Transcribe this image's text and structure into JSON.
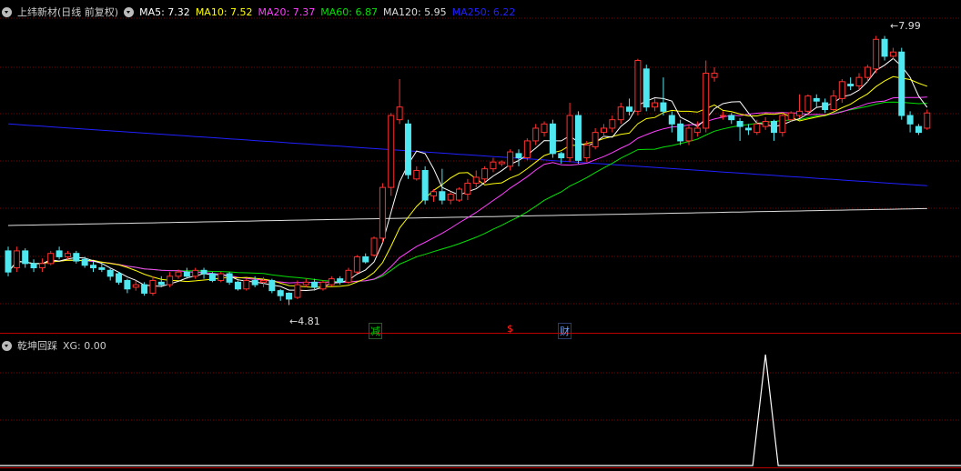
{
  "main_legend": {
    "stock": "上纬新材(日线 前复权)",
    "ma": [
      {
        "label": "MA5: 7.32",
        "color": "#ffffff"
      },
      {
        "label": "MA10: 7.52",
        "color": "#ffff00"
      },
      {
        "label": "MA20: 7.37",
        "color": "#ff40ff"
      },
      {
        "label": "MA60: 6.87",
        "color": "#00e000"
      },
      {
        "label": "MA120: 5.95",
        "color": "#dddddd"
      },
      {
        "label": "MA250: 6.22",
        "color": "#2020ff"
      }
    ]
  },
  "sub_legend": {
    "indicator": "乾坤回踩",
    "value_text": "XG: 0.00"
  },
  "annotations": {
    "high_label": "7.99",
    "low_label": "4.81",
    "markers": [
      {
        "text": "减",
        "color": "#00d000"
      },
      {
        "text": "$",
        "color": "#ff2020"
      },
      {
        "text": "财",
        "color": "#6aa0ff"
      }
    ]
  },
  "colors": {
    "up": "#ff3030",
    "down": "#50e8f0",
    "grid": "#7a0000",
    "ma5": "#ffffff",
    "ma10": "#ffff00",
    "ma20": "#ff40ff",
    "ma60": "#00e000",
    "ma120": "#dddddd",
    "ma250": "#2020ff",
    "xg": "#ffffff"
  },
  "chart_data": [
    {
      "type": "candlestick",
      "ylim": [
        4.6,
        8.2
      ],
      "candles": [
        [
          5.45,
          5.2,
          5.5,
          5.15
        ],
        [
          5.25,
          5.45,
          5.5,
          5.2
        ],
        [
          5.45,
          5.3,
          5.48,
          5.25
        ],
        [
          5.3,
          5.25,
          5.35,
          5.2
        ],
        [
          5.25,
          5.3,
          5.36,
          5.2
        ],
        [
          5.3,
          5.42,
          5.45,
          5.28
        ],
        [
          5.45,
          5.38,
          5.5,
          5.35
        ],
        [
          5.38,
          5.42,
          5.45,
          5.35
        ],
        [
          5.42,
          5.33,
          5.45,
          5.3
        ],
        [
          5.35,
          5.28,
          5.38,
          5.25
        ],
        [
          5.28,
          5.25,
          5.32,
          5.2
        ],
        [
          5.25,
          5.23,
          5.3,
          5.2
        ],
        [
          5.22,
          5.15,
          5.25,
          5.1
        ],
        [
          5.18,
          5.08,
          5.2,
          5.05
        ],
        [
          5.1,
          5.0,
          5.12,
          4.95
        ],
        [
          5.02,
          5.05,
          5.1,
          4.98
        ],
        [
          5.05,
          4.95,
          5.08,
          4.92
        ],
        [
          4.95,
          5.1,
          5.15,
          4.92
        ],
        [
          5.08,
          5.05,
          5.15,
          5.02
        ],
        [
          5.05,
          5.15,
          5.2,
          5.02
        ],
        [
          5.15,
          5.2,
          5.23,
          5.12
        ],
        [
          5.2,
          5.15,
          5.25,
          5.12
        ],
        [
          5.15,
          5.22,
          5.25,
          5.12
        ],
        [
          5.22,
          5.18,
          5.25,
          5.12
        ],
        [
          5.18,
          5.1,
          5.2,
          5.08
        ],
        [
          5.1,
          5.18,
          5.2,
          5.08
        ],
        [
          5.18,
          5.08,
          5.2,
          5.05
        ],
        [
          5.08,
          5.0,
          5.1,
          4.98
        ],
        [
          5.0,
          5.1,
          5.12,
          4.98
        ],
        [
          5.1,
          5.05,
          5.15,
          5.02
        ],
        [
          5.08,
          5.1,
          5.14,
          5.02
        ],
        [
          5.1,
          4.98,
          5.12,
          4.95
        ],
        [
          4.98,
          4.92,
          5.0,
          4.86
        ],
        [
          4.95,
          4.88,
          4.96,
          4.81
        ],
        [
          4.9,
          5.05,
          5.1,
          4.88
        ],
        [
          5.05,
          5.08,
          5.12,
          5.02
        ],
        [
          5.08,
          5.02,
          5.12,
          4.98
        ],
        [
          5.0,
          5.08,
          5.1,
          4.98
        ],
        [
          5.05,
          5.12,
          5.15,
          5.03
        ],
        [
          5.12,
          5.08,
          5.15,
          5.05
        ],
        [
          5.08,
          5.22,
          5.25,
          5.06
        ],
        [
          5.2,
          5.38,
          5.4,
          5.18
        ],
        [
          5.38,
          5.32,
          5.42,
          5.3
        ],
        [
          5.4,
          5.6,
          5.62,
          5.38
        ],
        [
          5.6,
          6.2,
          6.25,
          5.55
        ],
        [
          6.2,
          7.05,
          7.08,
          6.1
        ],
        [
          7.0,
          7.15,
          7.48,
          6.95
        ],
        [
          6.95,
          6.35,
          7.0,
          6.3
        ],
        [
          6.3,
          6.4,
          6.45,
          6.28
        ],
        [
          6.4,
          6.05,
          6.45,
          6.0
        ],
        [
          6.1,
          6.15,
          6.18,
          6.03
        ],
        [
          6.15,
          6.05,
          6.42,
          6.0
        ],
        [
          6.05,
          6.12,
          6.15,
          6.0
        ],
        [
          6.05,
          6.18,
          6.2,
          6.03
        ],
        [
          6.12,
          6.25,
          6.3,
          6.05
        ],
        [
          6.25,
          6.32,
          6.4,
          6.2
        ],
        [
          6.3,
          6.42,
          6.45,
          6.25
        ],
        [
          6.42,
          6.5,
          6.55,
          6.38
        ],
        [
          6.48,
          6.5,
          6.52,
          6.45
        ],
        [
          6.45,
          6.62,
          6.65,
          6.4
        ],
        [
          6.6,
          6.55,
          6.65,
          6.45
        ],
        [
          6.55,
          6.75,
          6.78,
          6.52
        ],
        [
          6.75,
          6.9,
          6.95,
          6.7
        ],
        [
          6.85,
          6.95,
          6.98,
          6.8
        ],
        [
          6.95,
          6.6,
          7.0,
          6.55
        ],
        [
          6.6,
          6.55,
          6.62,
          6.48
        ],
        [
          6.55,
          7.05,
          7.2,
          6.5
        ],
        [
          7.05,
          6.52,
          7.1,
          6.48
        ],
        [
          6.55,
          6.7,
          6.75,
          6.5
        ],
        [
          6.68,
          6.85,
          6.9,
          6.65
        ],
        [
          6.85,
          6.9,
          6.95,
          6.8
        ],
        [
          6.9,
          7.0,
          7.05,
          6.85
        ],
        [
          7.0,
          7.15,
          7.2,
          6.95
        ],
        [
          7.15,
          7.1,
          7.25,
          7.05
        ],
        [
          7.1,
          7.7,
          7.72,
          7.05
        ],
        [
          7.6,
          7.15,
          7.65,
          7.1
        ],
        [
          7.15,
          7.2,
          7.25,
          7.1
        ],
        [
          7.2,
          7.1,
          7.5,
          7.05
        ],
        [
          7.05,
          6.95,
          7.1,
          6.85
        ],
        [
          6.95,
          6.75,
          7.0,
          6.7
        ],
        [
          6.75,
          6.9,
          6.95,
          6.7
        ],
        [
          6.85,
          6.9,
          6.98,
          6.8
        ],
        [
          6.9,
          7.55,
          7.7,
          6.85
        ],
        [
          7.5,
          7.55,
          7.62,
          7.45
        ],
        [
          7.05,
          7.05,
          7.1,
          7.0
        ],
        [
          7.05,
          7.0,
          7.08,
          6.95
        ],
        [
          6.98,
          6.92,
          7.02,
          6.75
        ],
        [
          6.9,
          6.88,
          6.95,
          6.82
        ],
        [
          6.85,
          6.95,
          7.0,
          6.82
        ],
        [
          6.92,
          6.98,
          7.03,
          6.88
        ],
        [
          6.98,
          6.85,
          7.0,
          6.75
        ],
        [
          6.85,
          7.05,
          7.08,
          6.8
        ],
        [
          7.0,
          7.08,
          7.1,
          6.98
        ],
        [
          7.05,
          7.1,
          7.3,
          7.02
        ],
        [
          7.1,
          7.28,
          7.3,
          7.05
        ],
        [
          7.25,
          7.22,
          7.3,
          7.15
        ],
        [
          7.2,
          7.12,
          7.25,
          7.08
        ],
        [
          7.12,
          7.28,
          7.35,
          7.1
        ],
        [
          7.25,
          7.45,
          7.48,
          7.2
        ],
        [
          7.42,
          7.4,
          7.5,
          7.35
        ],
        [
          7.4,
          7.5,
          7.55,
          7.35
        ],
        [
          7.5,
          7.62,
          7.65,
          7.45
        ],
        [
          7.6,
          7.95,
          7.99,
          7.55
        ],
        [
          7.95,
          7.75,
          7.99,
          7.7
        ],
        [
          7.75,
          7.8,
          7.85,
          7.72
        ],
        [
          7.8,
          7.05,
          7.85,
          7.0
        ],
        [
          7.05,
          6.95,
          7.1,
          6.85
        ],
        [
          6.92,
          6.85,
          6.95,
          6.82
        ],
        [
          6.9,
          7.08,
          7.12,
          6.88
        ]
      ],
      "ma250": {
        "start": 6.95,
        "end": 6.22
      },
      "ma120": {
        "start": 5.75,
        "end": 5.95
      }
    },
    {
      "type": "line",
      "series": [
        {
          "name": "XG",
          "values": "spike of height 1 at candle index 89, 0 elsewhere"
        }
      ],
      "xg_spike_index": 89,
      "ylim": [
        0,
        1
      ]
    }
  ]
}
